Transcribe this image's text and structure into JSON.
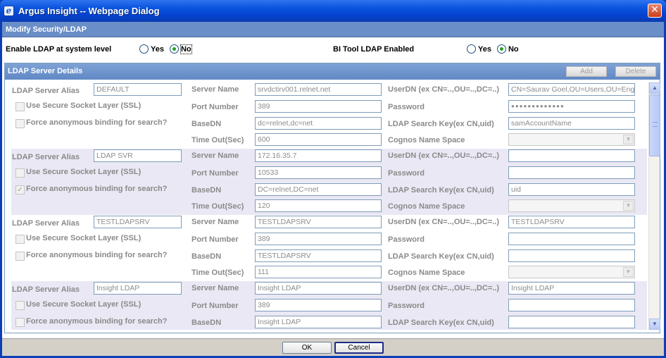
{
  "window": {
    "title": "Argus Insight -- Webpage Dialog",
    "app_icon": "ie-icon",
    "close_glyph": "✕"
  },
  "section_title": "Modify Security/LDAP",
  "enable_ldap": {
    "label": "Enable LDAP at system level",
    "yes": "Yes",
    "no": "No",
    "selected": "No"
  },
  "bi_tool": {
    "label": "BI Tool LDAP Enabled",
    "yes": "Yes",
    "no": "No",
    "selected": "No"
  },
  "ldap_details": {
    "title": "LDAP Server Details",
    "add_label": "Add",
    "delete_label": "Delete"
  },
  "labels": {
    "alias": "LDAP Server Alias",
    "ssl": "Use Secure Socket Layer (SSL)",
    "anon": "Force anonymous binding for search?",
    "server_name": "Server Name",
    "port": "Port Number",
    "basedn": "BaseDN",
    "timeout": "Time Out(Sec)",
    "userdn": "UserDN (ex CN=..,OU=..,DC=..)",
    "password": "Password",
    "search_key": "LDAP Search Key(ex CN,uid)",
    "cognos": "Cognos Name Space"
  },
  "servers": [
    {
      "alias": "DEFAULT",
      "ssl": false,
      "anon": false,
      "server_name": "srvdctirv001.relnet.net",
      "port": "389",
      "basedn": "dc=relnet,dc=net",
      "timeout": "600",
      "userdn": "CN=Saurav Goel,OU=Users,OU=Engi",
      "password": "●●●●●●●●●●●●●",
      "search_key": "samAccountName",
      "cognos": ""
    },
    {
      "alias": "LDAP SVR",
      "ssl": false,
      "anon": true,
      "server_name": "172.16.35.7",
      "port": "10533",
      "basedn": "DC=relnet,DC=net",
      "timeout": "120",
      "userdn": "",
      "password": "",
      "search_key": "uid",
      "cognos": ""
    },
    {
      "alias": "TESTLDAPSRV",
      "ssl": false,
      "anon": false,
      "server_name": "TESTLDAPSRV",
      "port": "389",
      "basedn": "TESTLDAPSRV",
      "timeout": "111",
      "userdn": "TESTLDAPSRV",
      "password": "",
      "search_key": "",
      "cognos": ""
    },
    {
      "alias": "Insight LDAP",
      "ssl": false,
      "anon": false,
      "server_name": "Insight LDAP",
      "port": "389",
      "basedn": "Insight LDAP",
      "timeout": "",
      "userdn": "Insight LDAP",
      "password": "",
      "search_key": "",
      "cognos": ""
    }
  ],
  "scrollbar": {
    "up_glyph": "▲",
    "down_glyph": "▼"
  },
  "footer": {
    "ok_label": "OK",
    "cancel_label": "Cancel"
  },
  "colors": {
    "title_blue": "#0442cf",
    "section_header": "#6a8ec7",
    "alt_row": "#eae8f4",
    "radio_on": "#21a121"
  }
}
